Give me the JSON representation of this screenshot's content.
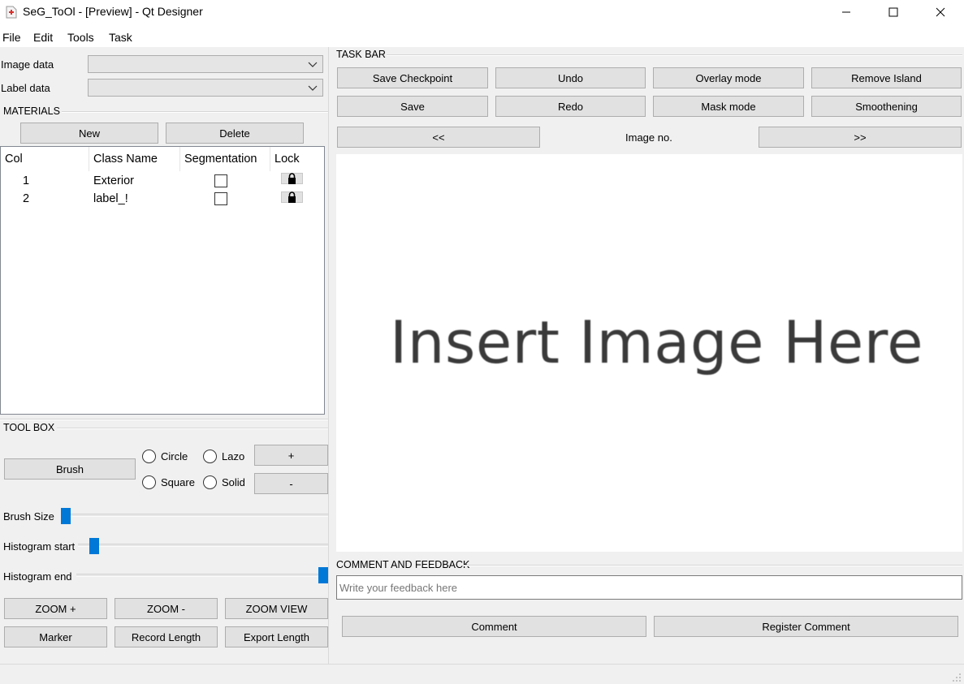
{
  "window": {
    "title": "SeG_ToOl - [Preview] - Qt Designer"
  },
  "menu": [
    "File",
    "Edit",
    "Tools",
    "Task"
  ],
  "left": {
    "image_data_label": "Image data",
    "label_data_label": "Label data",
    "materials_title": "MATERIALS",
    "new_label": "New",
    "delete_label": "Delete",
    "table": {
      "headers": [
        "Col",
        "Class Name",
        "Segmentation",
        "Lock"
      ],
      "rows": [
        {
          "col": "1",
          "name": "Exterior"
        },
        {
          "col": "2",
          "name": "label_!"
        }
      ]
    },
    "toolbox_title": "TOOL BOX",
    "brush_label": "Brush",
    "radios": [
      "Circle",
      "Lazo",
      "Square",
      "Solid"
    ],
    "plus_label": "+",
    "minus_label": "-",
    "brush_size_label": "Brush Size",
    "hist_start_label": "Histogram start",
    "hist_end_label": "Histogram end",
    "sliders": {
      "brush_size": 0,
      "hist_start": 0.05,
      "hist_end": 1.0
    },
    "zoom_plus": "ZOOM +",
    "zoom_minus": "ZOOM -",
    "zoom_view": "ZOOM VIEW",
    "marker": "Marker",
    "record_length": "Record Length",
    "export_length": "Export Length"
  },
  "right": {
    "taskbar_title": "TASK BAR",
    "save_checkpoint": "Save Checkpoint",
    "undo": "Undo",
    "overlay_mode": "Overlay mode",
    "remove_island": "Remove Island",
    "save": "Save",
    "redo": "Redo",
    "mask_mode": "Mask mode",
    "smoothening": "Smoothening",
    "prev": "<<",
    "image_no": "Image no.",
    "next": ">>",
    "canvas_text": "Insert Image Here",
    "comment_title": "COMMENT AND FEEDBACK",
    "feedback_placeholder": "Write your feedback here",
    "comment": "Comment",
    "register_comment": "Register Comment"
  },
  "colors": {
    "accent": "#0078d7",
    "window_bg": "#f0f0f0"
  }
}
